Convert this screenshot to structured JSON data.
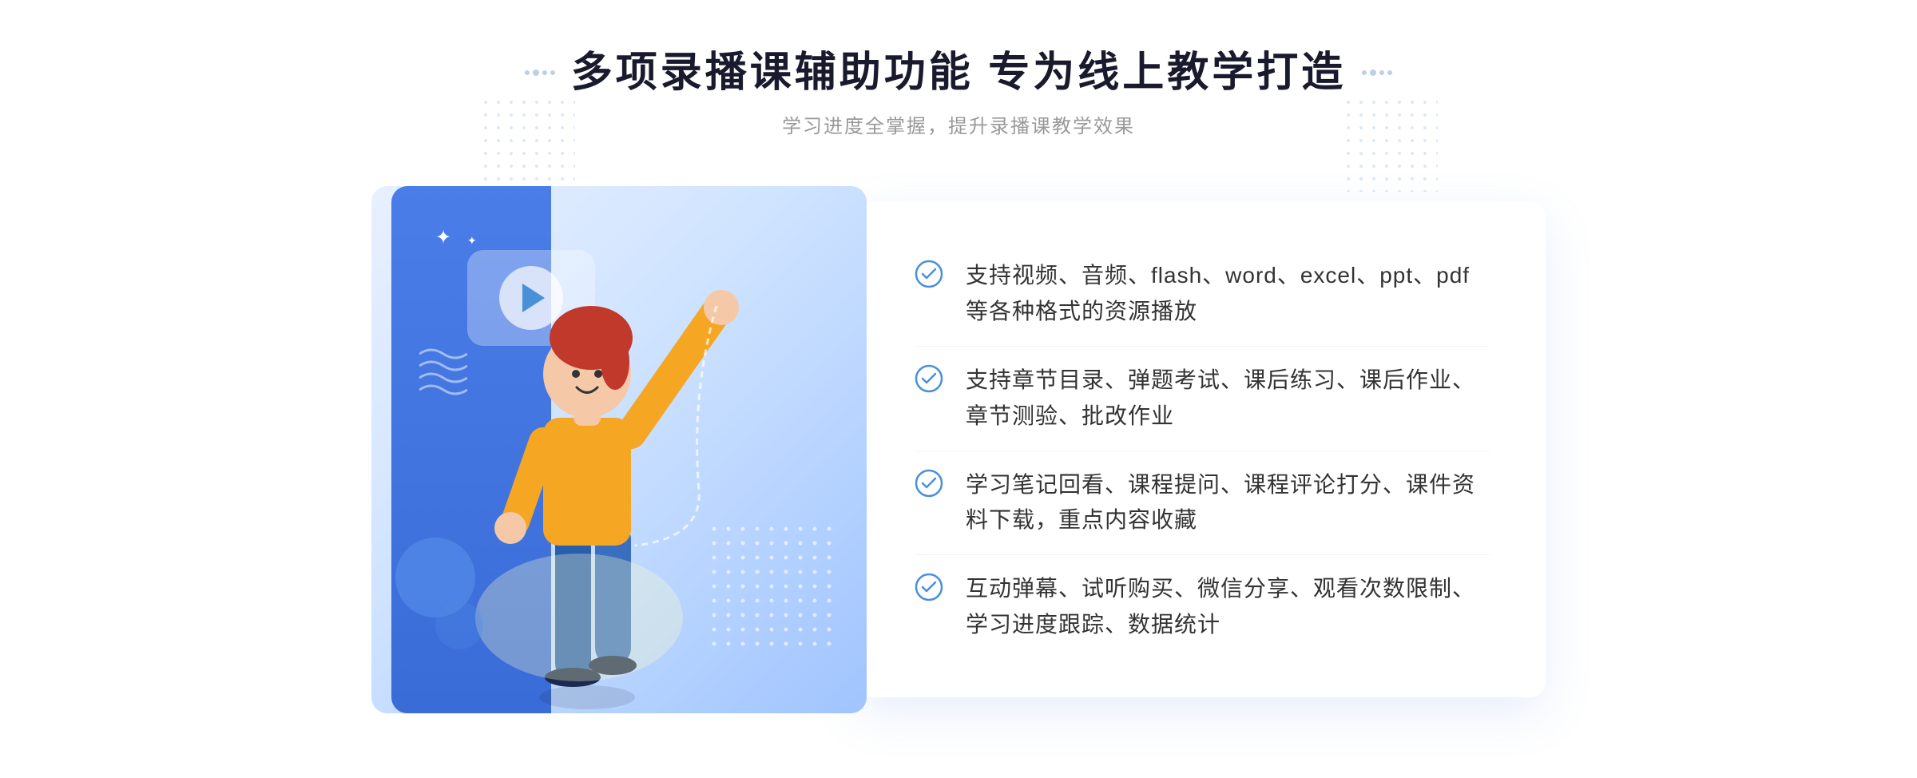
{
  "header": {
    "title": "多项录播课辅助功能 专为线上教学打造",
    "subtitle": "学习进度全掌握，提升录播课教学效果"
  },
  "features": [
    {
      "id": "feature-1",
      "text": "支持视频、音频、flash、word、excel、ppt、pdf等各种格式的资源播放"
    },
    {
      "id": "feature-2",
      "text": "支持章节目录、弹题考试、课后练习、课后作业、章节测验、批改作业"
    },
    {
      "id": "feature-3",
      "text": "学习笔记回看、课程提问、课程评论打分、课件资料下载，重点内容收藏"
    },
    {
      "id": "feature-4",
      "text": "互动弹幕、试听购买、微信分享、观看次数限制、学习进度跟踪、数据统计"
    }
  ],
  "decorators": {
    "left_arrows": "»",
    "check_icon_color": "#4a90d9",
    "title_accent_color": "#4a7de8"
  }
}
